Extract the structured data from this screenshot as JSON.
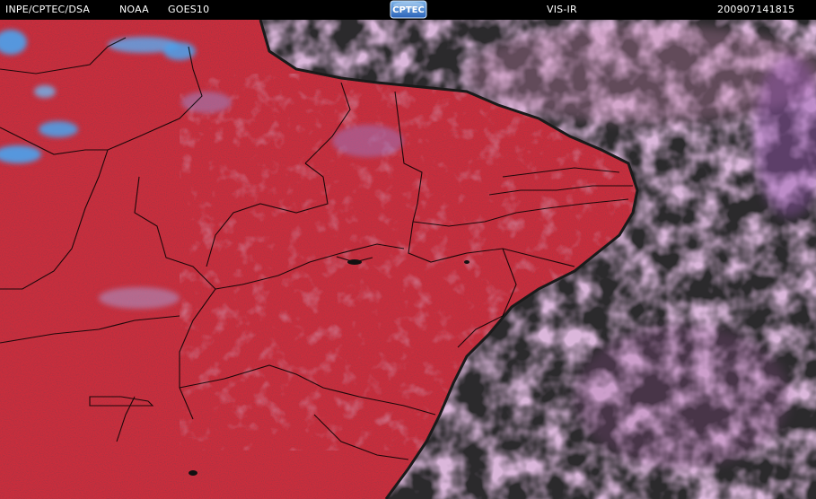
{
  "header": {
    "agency": "INPE/CPTEC/DSA",
    "operator": "NOAA",
    "satellite": "GOES10",
    "logo_text": "CPTEC",
    "product": "VIS-IR",
    "timestamp": "200907141815"
  },
  "colors": {
    "land": "#d2303f",
    "ocean": "#2b2a2c",
    "cloud_high": "#4aa3ee",
    "cloud_mid": "#b06aa8",
    "borders": "#000000",
    "bar": "#000000"
  }
}
